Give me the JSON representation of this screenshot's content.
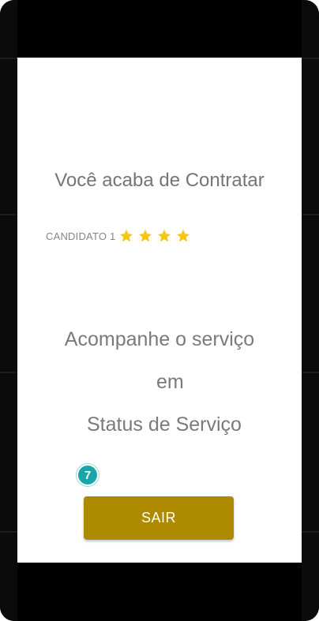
{
  "screen": {
    "title": "Você acaba de Contratar",
    "candidate": {
      "label": "CANDIDATO 1",
      "rating": 4,
      "max_rating": 4,
      "star_color": "#f5c518"
    },
    "message": {
      "line1": "Acompanhe o serviço",
      "line2": "em",
      "line3": "Status de Serviço"
    },
    "step_badge": "7",
    "exit_button_label": "SAIR"
  },
  "colors": {
    "button": "#ad8a00",
    "badge": "#1aa6a8",
    "text": "#7a7a7a",
    "frame": "#000000"
  }
}
